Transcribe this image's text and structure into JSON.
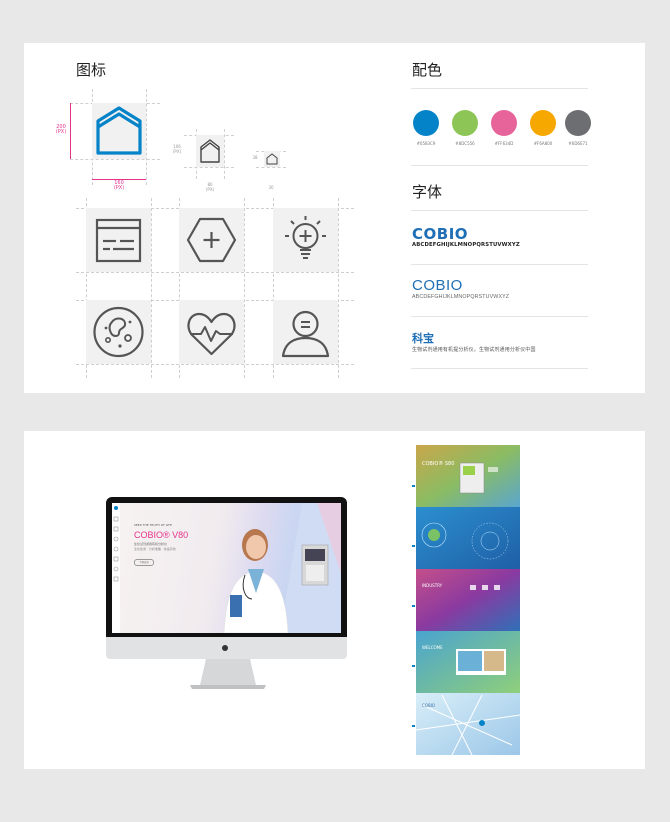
{
  "icons_section": {
    "title": "图标",
    "dims": {
      "large_height": "200",
      "large_height_unit": "(PX)",
      "large_width": "160",
      "large_width_unit": "(PX)",
      "medium_height": "106",
      "medium_height_unit": "(PX)",
      "medium_width": "80",
      "medium_width_unit": "(PX)",
      "small_height": "38",
      "small_width": "30"
    },
    "icon_names": [
      "home-icon",
      "browser-window-icon",
      "add-hexagon-icon",
      "lightbulb-add-icon",
      "cell-icon",
      "heartbeat-icon",
      "user-icon"
    ]
  },
  "colors_section": {
    "title": "配色",
    "swatches": [
      {
        "hex": "#0583C9",
        "label": "#0583C9"
      },
      {
        "hex": "#8DC556",
        "label": "#8DC556"
      },
      {
        "hex": "#F9634D",
        "label": "#FF634D",
        "display": "#e6649a"
      },
      {
        "hex": "#F6A800",
        "label": "#F6A800"
      },
      {
        "hex": "#6D6E71",
        "label": "#6D6E71"
      }
    ]
  },
  "fonts_section": {
    "title": "字体",
    "sample1_brand": "COBIO",
    "sample1_alphabet": "ABCDEFGHIJKLMNOPQRSTUVWXYZ",
    "sample2_brand": "COBIO",
    "sample2_alphabet": "ABCDEFGHIJKLMNOPQRSTUVWXYZ",
    "sample3_brand": "科宝",
    "sample3_text": "生物试剂通用有机提分析仪。生物试剂通用分析仪中国"
  },
  "showcase": {
    "screen_tagline": "SEEK THE TRUTH OF LIFE",
    "screen_title": "COBIO® V80",
    "screen_sub1": "生化试剂通用有机分析仪",
    "screen_sub2": "生化检测 · 分析准确 · 快速高效",
    "screen_button": "了解更多",
    "slide1_title": "COBIO® S80",
    "slide3_title": "INDUSTRY",
    "slide4_title": "WELCOME",
    "slide5_title": "COBIO"
  },
  "palette": {
    "blue": "#0583C9",
    "pink_dim": "#e5338c",
    "icon_stroke": "#555555",
    "brand_blue": "#1e6fb5"
  }
}
